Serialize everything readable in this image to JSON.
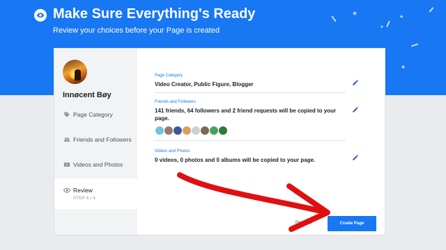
{
  "header": {
    "title": "Make Sure Everything's Ready",
    "subtitle": "Review your choices before your Page is created"
  },
  "profile": {
    "name": "Innøcent Bøy"
  },
  "sidebar": {
    "items": [
      {
        "label": "Page Category",
        "icon": "tag-icon"
      },
      {
        "label": "Friends and Followers",
        "icon": "people-icon"
      },
      {
        "label": "Videos and Photos",
        "icon": "video-icon"
      },
      {
        "label": "Review",
        "icon": "eye-icon",
        "step": "STEP 4 / 4"
      }
    ]
  },
  "sections": {
    "category": {
      "label": "Page Category",
      "value": "Video Creator, Public Figure, Blogger"
    },
    "friends": {
      "label": "Friends and Followers",
      "value": "141 friends, 64 followers and 2 friend requests will be copied to your page."
    },
    "media": {
      "label": "Videos and Photos",
      "value": "0 videos, 0 photos and 0 albums will be copied to your page."
    }
  },
  "buttons": {
    "previous": "Previous",
    "create": "Create Page"
  },
  "colors": {
    "brand": "#1877f2",
    "annotation_arrow": "#e01010"
  }
}
